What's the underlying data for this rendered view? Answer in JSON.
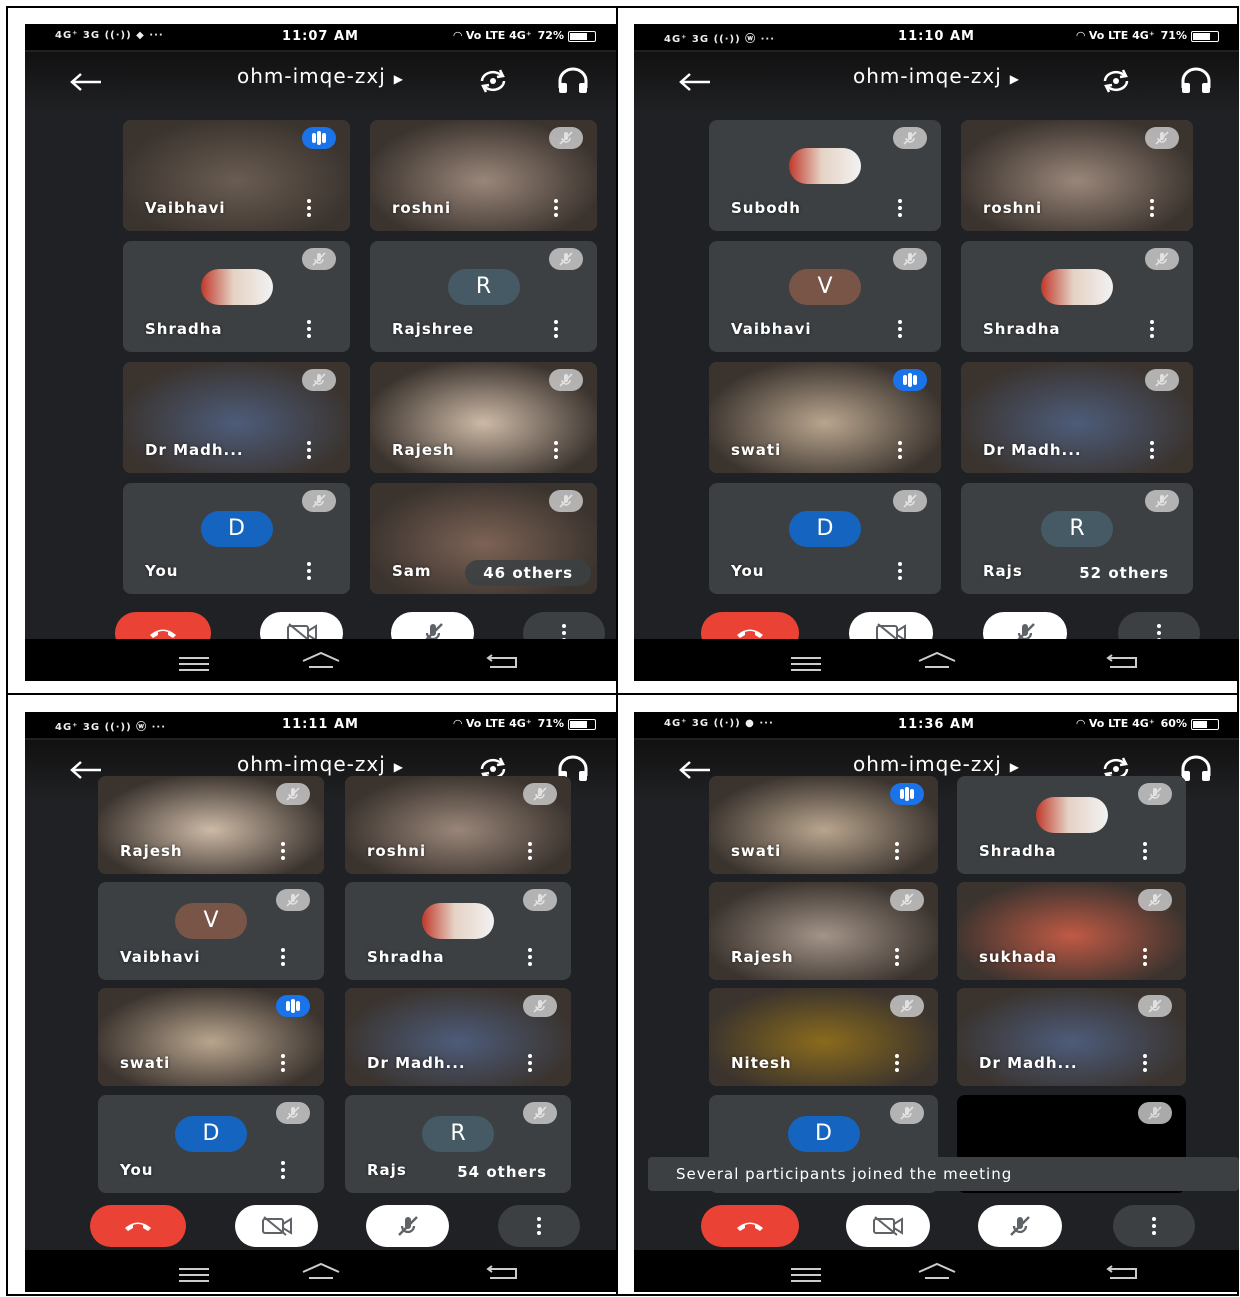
{
  "screens": [
    {
      "status": {
        "time": "11:07 AM",
        "left_icons": "4G⁺ 3G ((·)) ◆ ···",
        "battery": "72%",
        "net": "◠ Vo LTE 4G⁺"
      },
      "meeting_code": "ohm-imqe-zxj",
      "tiles": [
        {
          "name": "Vaibhavi",
          "kind": "video",
          "speaking": true,
          "tone": "#6a5d52"
        },
        {
          "name": "roshni",
          "kind": "video",
          "speaking": false,
          "tone": "#9a8679"
        },
        {
          "name": "Shradha",
          "kind": "photo",
          "speaking": false
        },
        {
          "name": "Rajshree",
          "kind": "letter",
          "letter": "R",
          "avatar_color": "#455a64",
          "speaking": false
        },
        {
          "name": "Dr Madh...",
          "kind": "video",
          "speaking": false,
          "tone": "#4d5c7a"
        },
        {
          "name": "Rajesh",
          "kind": "video",
          "speaking": false,
          "tone": "#cdb9a6"
        },
        {
          "name": "You",
          "kind": "letter",
          "letter": "D",
          "avatar_color": "#1565c0",
          "speaking": false
        },
        {
          "name": "Sam",
          "kind": "video",
          "speaking": false,
          "tone": "#7d6355",
          "others": "46 others"
        }
      ]
    },
    {
      "status": {
        "time": "11:10 AM",
        "left_icons": "4G⁺ 3G ((·)) ⓦ ···",
        "battery": "71%",
        "net": "◠ Vo LTE 4G⁺"
      },
      "meeting_code": "ohm-imqe-zxj",
      "tiles": [
        {
          "name": "Subodh",
          "kind": "photo",
          "speaking": false
        },
        {
          "name": "roshni",
          "kind": "video",
          "speaking": false,
          "tone": "#9a8679"
        },
        {
          "name": "Vaibhavi",
          "kind": "letter",
          "letter": "V",
          "avatar_color": "#795548",
          "speaking": false
        },
        {
          "name": "Shradha",
          "kind": "photo",
          "speaking": false
        },
        {
          "name": "swati",
          "kind": "video",
          "speaking": true,
          "tone": "#b9a58e"
        },
        {
          "name": "Dr Madh...",
          "kind": "video",
          "speaking": false,
          "tone": "#4d5c7a"
        },
        {
          "name": "You",
          "kind": "letter",
          "letter": "D",
          "avatar_color": "#1565c0",
          "speaking": false
        },
        {
          "name": "Rajs",
          "kind": "letter",
          "letter": "R",
          "avatar_color": "#455a64",
          "speaking": false,
          "others": "52 others"
        }
      ]
    },
    {
      "status": {
        "time": "11:11 AM",
        "left_icons": "4G⁺ 3G ((·)) ⓦ ···",
        "battery": "71%",
        "net": "◠ Vo LTE 4G⁺"
      },
      "meeting_code": "ohm-imqe-zxj",
      "tiles": [
        {
          "name": "Rajesh",
          "kind": "video",
          "speaking": false,
          "tone": "#cdb9a6"
        },
        {
          "name": "roshni",
          "kind": "video",
          "speaking": false,
          "tone": "#9a8679"
        },
        {
          "name": "Vaibhavi",
          "kind": "letter",
          "letter": "V",
          "avatar_color": "#795548",
          "speaking": false
        },
        {
          "name": "Shradha",
          "kind": "photo",
          "speaking": false
        },
        {
          "name": "swati",
          "kind": "video",
          "speaking": true,
          "tone": "#b9a58e"
        },
        {
          "name": "Dr Madh...",
          "kind": "video",
          "speaking": false,
          "tone": "#4d5c7a"
        },
        {
          "name": "You",
          "kind": "letter",
          "letter": "D",
          "avatar_color": "#1565c0",
          "speaking": false
        },
        {
          "name": "Rajs",
          "kind": "letter",
          "letter": "R",
          "avatar_color": "#455a64",
          "speaking": false,
          "others": "54 others"
        }
      ]
    },
    {
      "status": {
        "time": "11:36 AM",
        "left_icons": "4G⁺ 3G ((·)) ● ···",
        "battery": "60%",
        "net": "◠ Vo LTE 4G⁺"
      },
      "meeting_code": "ohm-imqe-zxj",
      "tiles": [
        {
          "name": "swati",
          "kind": "video",
          "speaking": true,
          "tone": "#b9a58e"
        },
        {
          "name": "Shradha",
          "kind": "photo",
          "speaking": false
        },
        {
          "name": "Rajesh",
          "kind": "video",
          "speaking": false,
          "tone": "#a39488"
        },
        {
          "name": "sukhada",
          "kind": "video",
          "speaking": false,
          "tone": "#c05a45"
        },
        {
          "name": "Nitesh",
          "kind": "video",
          "speaking": false,
          "tone": "#8a6b1c"
        },
        {
          "name": "Dr Madh...",
          "kind": "video",
          "speaking": false,
          "tone": "#4d5c7a"
        },
        {
          "name": "",
          "kind": "letter",
          "letter": "D",
          "avatar_color": "#1565c0",
          "speaking": false
        },
        {
          "name": "",
          "kind": "black",
          "speaking": false
        }
      ],
      "toast": "Several participants joined the meeting"
    }
  ]
}
